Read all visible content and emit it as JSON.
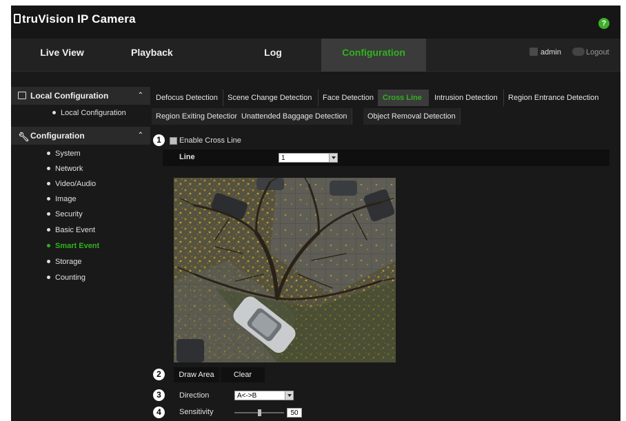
{
  "app": {
    "title": "truVision IP Camera",
    "help_label": "?"
  },
  "nav": {
    "tabs": [
      {
        "label": "Live View"
      },
      {
        "label": "Playback"
      },
      {
        "label": "Log"
      },
      {
        "label": "Configuration",
        "active": true
      }
    ],
    "user": "admin",
    "logout": "Logout"
  },
  "sidebar": {
    "local": {
      "title": "Local Configuration",
      "items": [
        "Local Configuration"
      ]
    },
    "config": {
      "title": "Configuration",
      "items": [
        "System",
        "Network",
        "Video/Audio",
        "Image",
        "Security",
        "Basic Event",
        "Smart Event",
        "Storage",
        "Counting"
      ],
      "active": "Smart Event"
    }
  },
  "subtabs": {
    "row1": [
      "Defocus Detection",
      "Scene Change Detection",
      "Face Detection",
      "Cross Line",
      "Intrusion Detection",
      "Region Entrance Detection"
    ],
    "row2": [
      "Region Exiting Detection",
      "Unattended Baggage Detection",
      "Object Removal Detection"
    ],
    "active": "Cross Line"
  },
  "form": {
    "enable_label": "Enable Cross Line",
    "line_label": "Line",
    "line_value": "1",
    "draw_area": "Draw Area",
    "clear": "Clear",
    "direction_label": "Direction",
    "direction_value": "A<->B",
    "sensitivity_label": "Sensitivity",
    "sensitivity_value": "50"
  },
  "callouts": [
    "1",
    "2",
    "3",
    "4"
  ],
  "colors": {
    "accent": "#2fb31c",
    "background": "#191919",
    "help": "#3fae2a"
  }
}
